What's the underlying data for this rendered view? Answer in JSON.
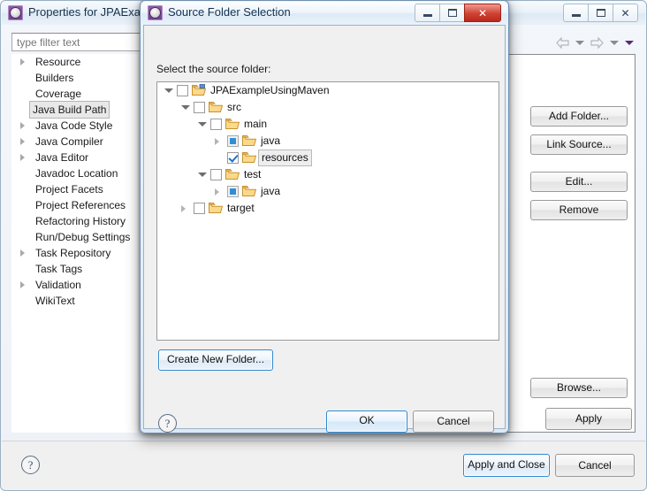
{
  "outer_window": {
    "title": "Properties for JPAExample",
    "icon": "eclipse-icon",
    "controls": {
      "minimize": "–",
      "maximize": "□",
      "close": "✕"
    },
    "filter": {
      "placeholder": "type filter text",
      "value": ""
    },
    "nav_items": [
      {
        "label": "Resource",
        "expandable": true,
        "selected": false
      },
      {
        "label": "Builders",
        "expandable": false,
        "selected": false
      },
      {
        "label": "Coverage",
        "expandable": false,
        "selected": false
      },
      {
        "label": "Java Build Path",
        "expandable": false,
        "selected": true
      },
      {
        "label": "Java Code Style",
        "expandable": true,
        "selected": false
      },
      {
        "label": "Java Compiler",
        "expandable": true,
        "selected": false
      },
      {
        "label": "Java Editor",
        "expandable": true,
        "selected": false
      },
      {
        "label": "Javadoc Location",
        "expandable": false,
        "selected": false
      },
      {
        "label": "Project Facets",
        "expandable": false,
        "selected": false
      },
      {
        "label": "Project References",
        "expandable": false,
        "selected": false
      },
      {
        "label": "Refactoring History",
        "expandable": false,
        "selected": false
      },
      {
        "label": "Run/Debug Settings",
        "expandable": false,
        "selected": false
      },
      {
        "label": "Task Repository",
        "expandable": true,
        "selected": false
      },
      {
        "label": "Task Tags",
        "expandable": false,
        "selected": false
      },
      {
        "label": "Validation",
        "expandable": true,
        "selected": false
      },
      {
        "label": "WikiText",
        "expandable": false,
        "selected": false
      }
    ],
    "page_buttons": [
      {
        "label": "Add Folder..."
      },
      {
        "label": "Link Source..."
      },
      {
        "label": "Edit..."
      },
      {
        "label": "Remove"
      }
    ],
    "browse_label": "Browse...",
    "apply_label": "Apply",
    "bottom": {
      "help": "?",
      "apply_and_close": "Apply and Close",
      "cancel": "Cancel"
    }
  },
  "inner_dialog": {
    "title": "Source Folder Selection",
    "icon": "eclipse-icon",
    "controls": {
      "minimize": "–",
      "maximize": "□",
      "close": "✕"
    },
    "prompt": "Select the source folder:",
    "tree": [
      {
        "label": "JPAExampleUsingMaven",
        "depth": 0,
        "twisty": "down",
        "check": "unchecked",
        "icon": "project-folder-icon",
        "selected": false
      },
      {
        "label": "src",
        "depth": 1,
        "twisty": "down",
        "check": "unchecked",
        "icon": "folder-icon",
        "selected": false
      },
      {
        "label": "main",
        "depth": 2,
        "twisty": "down",
        "check": "unchecked",
        "icon": "folder-icon",
        "selected": false
      },
      {
        "label": "java",
        "depth": 3,
        "twisty": "right",
        "check": "grayed",
        "icon": "folder-icon",
        "selected": false
      },
      {
        "label": "resources",
        "depth": 3,
        "twisty": "none",
        "check": "checked",
        "icon": "folder-icon",
        "selected": true
      },
      {
        "label": "test",
        "depth": 2,
        "twisty": "down",
        "check": "unchecked",
        "icon": "folder-icon",
        "selected": false
      },
      {
        "label": "java",
        "depth": 3,
        "twisty": "right",
        "check": "grayed",
        "icon": "folder-icon",
        "selected": false
      },
      {
        "label": "target",
        "depth": 1,
        "twisty": "right",
        "check": "unchecked",
        "icon": "folder-icon",
        "selected": false
      }
    ],
    "create_new_folder": "Create New Folder...",
    "help": "?",
    "ok": "OK",
    "cancel": "Cancel"
  },
  "colors": {
    "accent_blue": "#2f89d0",
    "check_blue": "#1b74c4",
    "grayed_blue": "#2f8fd6",
    "close_red": "#cf4233",
    "eclipse_purple": "#6f3f8c",
    "dialog_bg": "#f0f0f0",
    "titlebar_blue": "#ddeaf6"
  }
}
